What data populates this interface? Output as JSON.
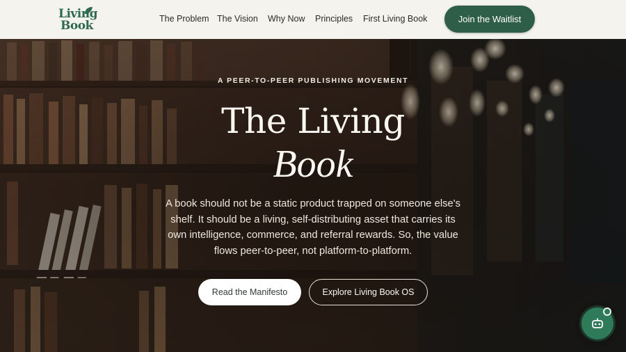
{
  "header": {
    "logo": {
      "line1": "Living",
      "line2": "Book"
    },
    "nav": [
      "The Problem",
      "The Vision",
      "Why Now",
      "Principles",
      "First Living Book"
    ],
    "cta_label": "Join the Waitlist"
  },
  "hero": {
    "eyebrow": "A PEER-TO-PEER PUBLISHING MOVEMENT",
    "title_line1": "The Living",
    "title_line2": "Book",
    "description": "A book should not be a static product trapped on someone else's shelf. It should be a living, self-distributing asset that carries its own intelligence, commerce, and referral rewards. So, the value flows peer-to-peer, not platform-to-platform.",
    "primary_button": "Read the Manifesto",
    "secondary_button": "Explore Living Book OS"
  },
  "chat_widget": {
    "icon": "robot-icon"
  },
  "colors": {
    "brand_green": "#2f5e48",
    "header_bg": "#f5f3ee",
    "chat_green": "#2f7a59"
  }
}
